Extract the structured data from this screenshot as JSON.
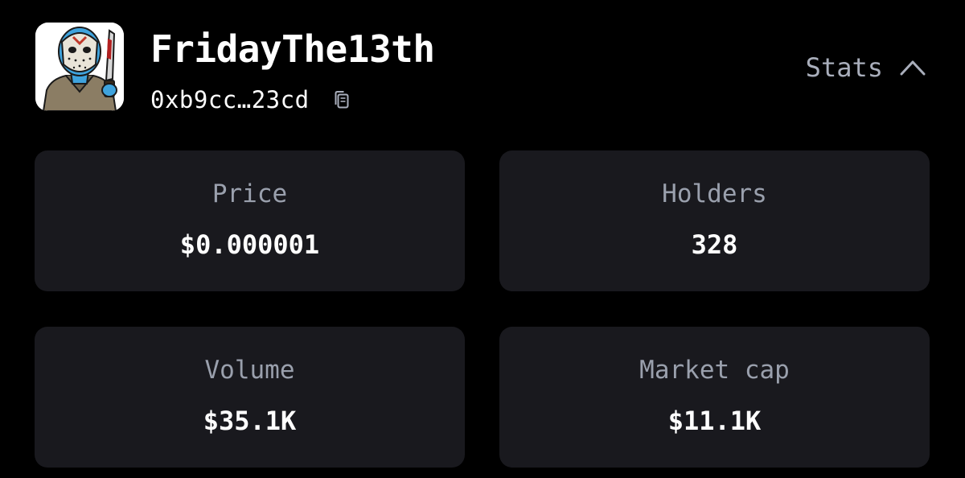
{
  "token": {
    "name": "FridayThe13th",
    "address": "0xb9cc…23cd",
    "avatar_icon": "hockey-mask-character-avatar",
    "copy_icon": "copy-icon"
  },
  "header": {
    "stats_label": "Stats",
    "stats_chevron": "chevron-up-icon"
  },
  "stats": [
    {
      "label": "Price",
      "value": "$0.000001"
    },
    {
      "label": "Holders",
      "value": "328"
    },
    {
      "label": "Volume",
      "value": "$35.1K"
    },
    {
      "label": "Market cap",
      "value": "$11.1K"
    }
  ],
  "colors": {
    "background": "#000000",
    "card": "#19191e",
    "label": "#9aa0ad",
    "value": "#ffffff"
  }
}
